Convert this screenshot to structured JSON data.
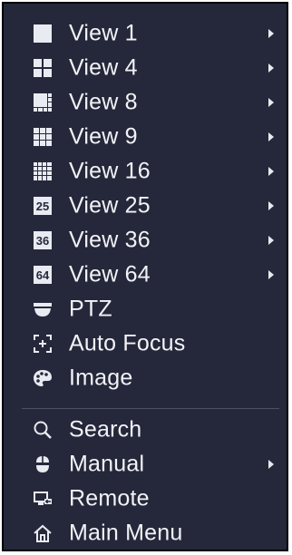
{
  "menu": {
    "items": [
      {
        "label": "View 1",
        "icon": "view-1-icon",
        "submenu": true
      },
      {
        "label": "View 4",
        "icon": "view-4-icon",
        "submenu": true
      },
      {
        "label": "View 8",
        "icon": "view-8-icon",
        "submenu": true
      },
      {
        "label": "View 9",
        "icon": "view-9-icon",
        "submenu": true
      },
      {
        "label": "View 16",
        "icon": "view-16-icon",
        "submenu": true
      },
      {
        "label": "View 25",
        "icon": "view-25-icon",
        "submenu": true
      },
      {
        "label": "View 36",
        "icon": "view-36-icon",
        "submenu": true
      },
      {
        "label": "View 64",
        "icon": "view-64-icon",
        "submenu": true
      },
      {
        "label": "PTZ",
        "icon": "ptz-camera-icon",
        "submenu": false
      },
      {
        "label": "Auto Focus",
        "icon": "auto-focus-icon",
        "submenu": false
      },
      {
        "label": "Image",
        "icon": "image-palette-icon",
        "submenu": false
      },
      {
        "label": "Search",
        "icon": "search-icon",
        "submenu": false
      },
      {
        "label": "Manual",
        "icon": "manual-mouse-icon",
        "submenu": true
      },
      {
        "label": "Remote",
        "icon": "remote-device-icon",
        "submenu": false
      },
      {
        "label": "Main Menu",
        "icon": "home-icon",
        "submenu": false
      }
    ],
    "icon_text": {
      "view25": "25",
      "view36": "36",
      "view64": "64"
    },
    "colors": {
      "background": "#25283a",
      "text": "#f2f3f7",
      "icon": "#e9ebf2",
      "divider": "#4a5066"
    }
  }
}
